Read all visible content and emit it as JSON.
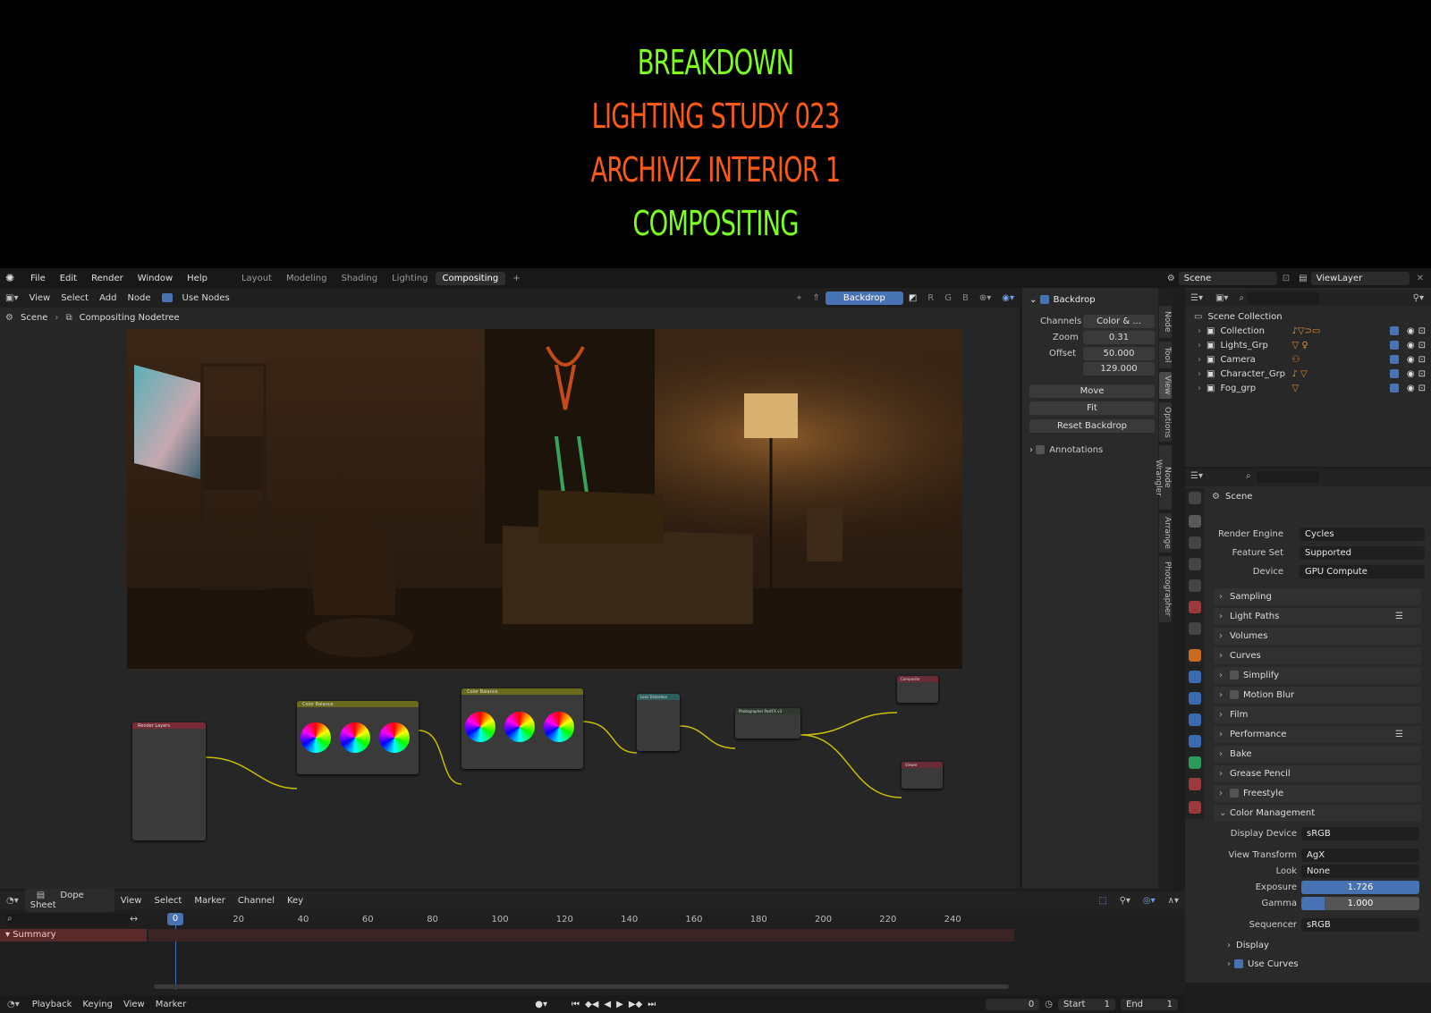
{
  "title": {
    "line1": "BREAKDOWN",
    "line2": "LIGHTING  STUDY  023",
    "line3": "ARCHIVIZ INTERIOR 1",
    "line4": "COMPOSITING"
  },
  "topbar": {
    "menus": [
      "File",
      "Edit",
      "Render",
      "Window",
      "Help"
    ],
    "workspaces": [
      "Layout",
      "Modeling",
      "Shading",
      "Lighting",
      "Compositing"
    ],
    "active_workspace": "Compositing",
    "add_tab": "+",
    "scene": "Scene",
    "view_layer": "ViewLayer"
  },
  "node_editor": {
    "header": {
      "view": "View",
      "select": "Select",
      "add": "Add",
      "node": "Node",
      "use_nodes": "Use Nodes",
      "backdrop": "Backdrop",
      "channels": [
        "R",
        "G",
        "B"
      ]
    },
    "breadcrumb": {
      "scene": "Scene",
      "tree": "Compositing Nodetree"
    },
    "nodes": {
      "render_layers": "Render Layers",
      "color_balance_1": "Color Balance",
      "color_balance_2": "Color Balance",
      "lens_distortion": "Lens Distortion",
      "photographer": "Photographer PostFX v3",
      "composite": "Composite",
      "viewer": "Viewer"
    }
  },
  "n_panel": {
    "section": "Backdrop",
    "channels_label": "Channels",
    "channels_value": "Color & ...",
    "zoom_label": "Zoom",
    "zoom_value": "0.31",
    "offset_label": "Offset",
    "offset_x": "50.000",
    "offset_y": "129.000",
    "move": "Move",
    "fit": "Fit",
    "reset_backdrop": "Reset Backdrop",
    "annotations": "Annotations",
    "tabs": [
      "Node",
      "Tool",
      "View",
      "Options",
      "Node Wrangler",
      "Arrange",
      "Photographer"
    ]
  },
  "outliner": {
    "root": "Scene Collection",
    "items": [
      "Collection",
      "Lights_Grp",
      "Camera",
      "Character_Grp",
      "Fog_grp"
    ]
  },
  "properties": {
    "context": "Scene",
    "render_engine_label": "Render Engine",
    "render_engine": "Cycles",
    "feature_set_label": "Feature Set",
    "feature_set": "Supported",
    "device_label": "Device",
    "device": "GPU Compute",
    "sections": [
      "Sampling",
      "Light Paths",
      "Volumes",
      "Curves",
      "Simplify",
      "Motion Blur",
      "Film",
      "Performance",
      "Bake",
      "Grease Pencil",
      "Freestyle",
      "Color Management"
    ],
    "display_device_label": "Display Device",
    "display_device": "sRGB",
    "view_transform_label": "View Transform",
    "view_transform": "AgX",
    "look_label": "Look",
    "look": "None",
    "exposure_label": "Exposure",
    "exposure": "1.726",
    "exposure_fill": 1.0,
    "gamma_label": "Gamma",
    "gamma": "1.000",
    "gamma_fill": 0.2,
    "sequencer_label": "Sequencer",
    "sequencer": "sRGB",
    "display": "Display",
    "use_curves": "Use Curves"
  },
  "timeline": {
    "mode": "Dope Sheet",
    "menus": [
      "View",
      "Select",
      "Marker",
      "Channel",
      "Key"
    ],
    "current_frame_badge": "0",
    "ruler": [
      "20",
      "40",
      "60",
      "80",
      "100",
      "120",
      "140",
      "160",
      "180",
      "200",
      "220",
      "240"
    ],
    "summary": "Summary",
    "playback": "Playback",
    "keying": "Keying",
    "view": "View",
    "marker": "Marker",
    "frame": "0",
    "start_label": "Start",
    "start": "1",
    "end_label": "End",
    "end": "1"
  },
  "colors": {
    "title_green": "#7cff1e",
    "title_orange": "#ff5a14",
    "accent_blue": "#4772b3"
  }
}
